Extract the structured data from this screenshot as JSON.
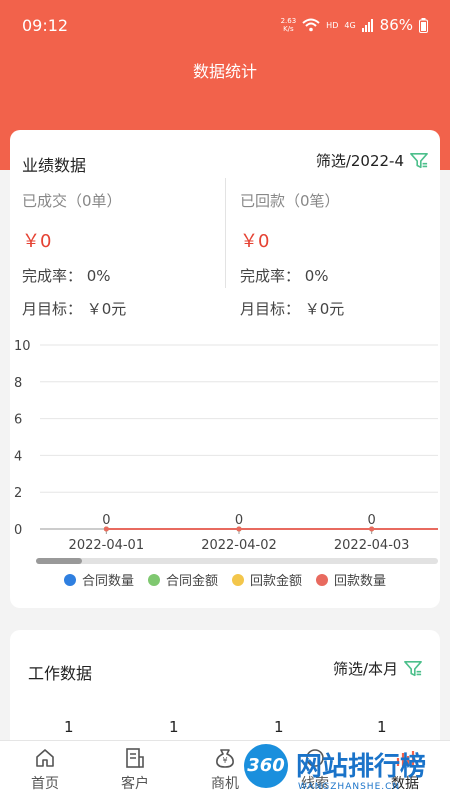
{
  "status_bar": {
    "time": "09:12",
    "net_speed_top": "2.63",
    "net_speed_bottom": "K/s",
    "hd": "HD",
    "lte": "4G",
    "battery": "86%"
  },
  "header": {
    "title": "数据统计"
  },
  "performance": {
    "title": "业绩数据",
    "filter_label": "筛选/2022-4",
    "deals": {
      "label": "已成交（0单）",
      "amount": "￥0",
      "rate": "完成率：  0%",
      "target": "月目标：  ￥0元"
    },
    "payments": {
      "label": "已回款（0笔）",
      "amount": "￥0",
      "rate": "完成率：  0%",
      "target": "月目标：  ￥0元"
    }
  },
  "chart_data": {
    "type": "line",
    "categories": [
      "2022-04-01",
      "2022-04-02",
      "2022-04-03"
    ],
    "ylim": [
      0,
      10
    ],
    "yticks": [
      "0",
      "2",
      "4",
      "6",
      "8",
      "10"
    ],
    "series": [
      {
        "name": "合同数量",
        "values": [
          0,
          0,
          0
        ],
        "color": "#2f7fe0"
      },
      {
        "name": "合同金额",
        "values": [
          0,
          0,
          0
        ],
        "color": "#7fc870"
      },
      {
        "name": "回款金额",
        "values": [
          0,
          0,
          0
        ],
        "color": "#f3c64b"
      },
      {
        "name": "回款数量",
        "values": [
          0,
          0,
          0
        ],
        "color": "#e86a5f"
      }
    ],
    "data_labels": [
      "0",
      "0",
      "0"
    ],
    "legend_position": "bottom"
  },
  "work": {
    "title": "工作数据",
    "filter_label": "筛选/本月",
    "counts": [
      "1",
      "1",
      "1",
      "1"
    ]
  },
  "tabbar": {
    "items": [
      {
        "label": "首页",
        "icon": "home-icon"
      },
      {
        "label": "客户",
        "icon": "customer-icon"
      },
      {
        "label": "商机",
        "icon": "opportunity-icon"
      },
      {
        "label": "线索",
        "icon": "lead-icon"
      },
      {
        "label": "数据",
        "icon": "data-icon"
      }
    ]
  },
  "watermark": {
    "logo_text": "360",
    "text": "网站排行榜",
    "sub": "WANGZHANSHE.CN"
  },
  "colors": {
    "header": "#f2624b",
    "accent_green": "#4cbf8b",
    "amount_red": "#e54233"
  }
}
